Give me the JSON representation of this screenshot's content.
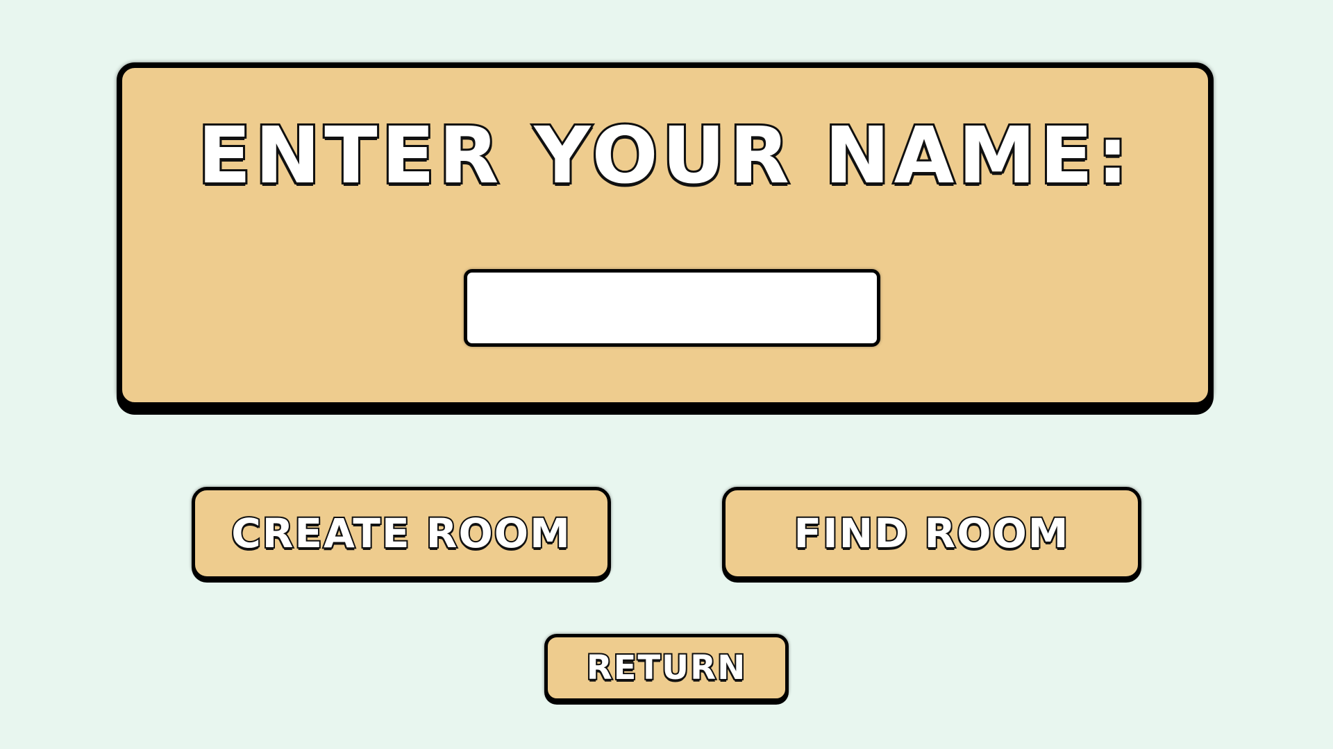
{
  "screen": {
    "background_color": "#e8f6ef",
    "panel_color": "#eecc8e",
    "outline_color": "#000000",
    "text_color": "#ffffff"
  },
  "name_panel": {
    "title": "ENTER YOUR NAME:",
    "name_input": {
      "value": "",
      "placeholder": ""
    }
  },
  "buttons": {
    "create_room": "CREATE ROOM",
    "find_room": "FIND ROOM",
    "return": "RETURN"
  }
}
